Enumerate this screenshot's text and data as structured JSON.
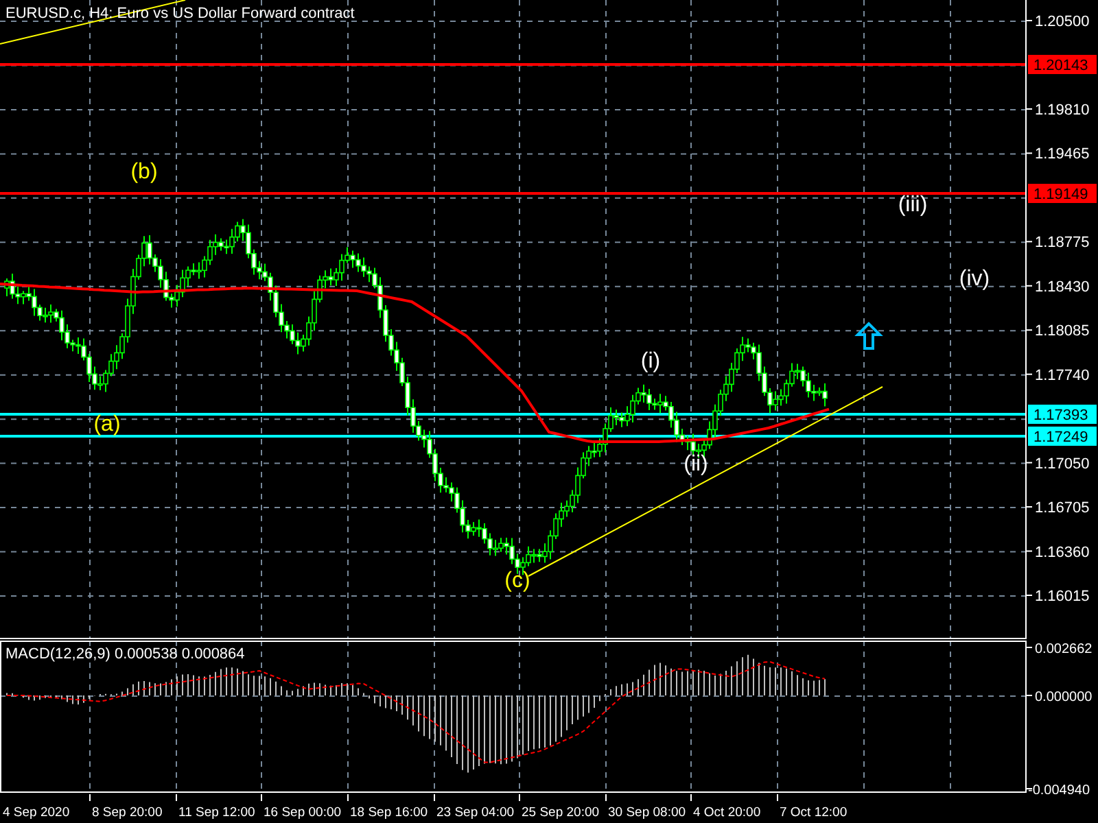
{
  "title": "EURUSD.c, H4:  Euro vs US Dollar Forward contract",
  "price_axis": [
    "1.20500",
    "1.19810",
    "1.19465",
    "1.18775",
    "1.18430",
    "1.18085",
    "1.17740",
    "1.17050",
    "1.16705",
    "1.16360",
    "1.16015"
  ],
  "price_levels": [
    {
      "label": "1.20143",
      "color": "#ff0000"
    },
    {
      "label": "1.19149",
      "color": "#ff0000"
    },
    {
      "label": "1.17393",
      "color": "#00ffff"
    },
    {
      "label": "1.17249",
      "color": "#00ffff"
    }
  ],
  "wave_labels": [
    {
      "text": "(b)",
      "color": "#ffff00"
    },
    {
      "text": "(a)",
      "color": "#ffff00"
    },
    {
      "text": "(c)",
      "color": "#ffff00"
    },
    {
      "text": "(i)",
      "color": "#ffffff"
    },
    {
      "text": "(ii)",
      "color": "#ffffff"
    },
    {
      "text": "(iii)",
      "color": "#ffffff"
    },
    {
      "text": "(iv)",
      "color": "#ffffff"
    }
  ],
  "indicator": {
    "label": "MACD(12,26,9) 0.000538 0.000864",
    "axis": [
      "0.002662",
      "0.000000",
      "-0.004940"
    ]
  },
  "time_axis": [
    "4 Sep 2020",
    "8 Sep 20:00",
    "11 Sep 12:00",
    "16 Sep 00:00",
    "18 Sep 16:00",
    "23 Sep 04:00",
    "25 Sep 20:00",
    "30 Sep 08:00",
    "4 Oct 20:00",
    "7 Oct 12:00"
  ]
}
